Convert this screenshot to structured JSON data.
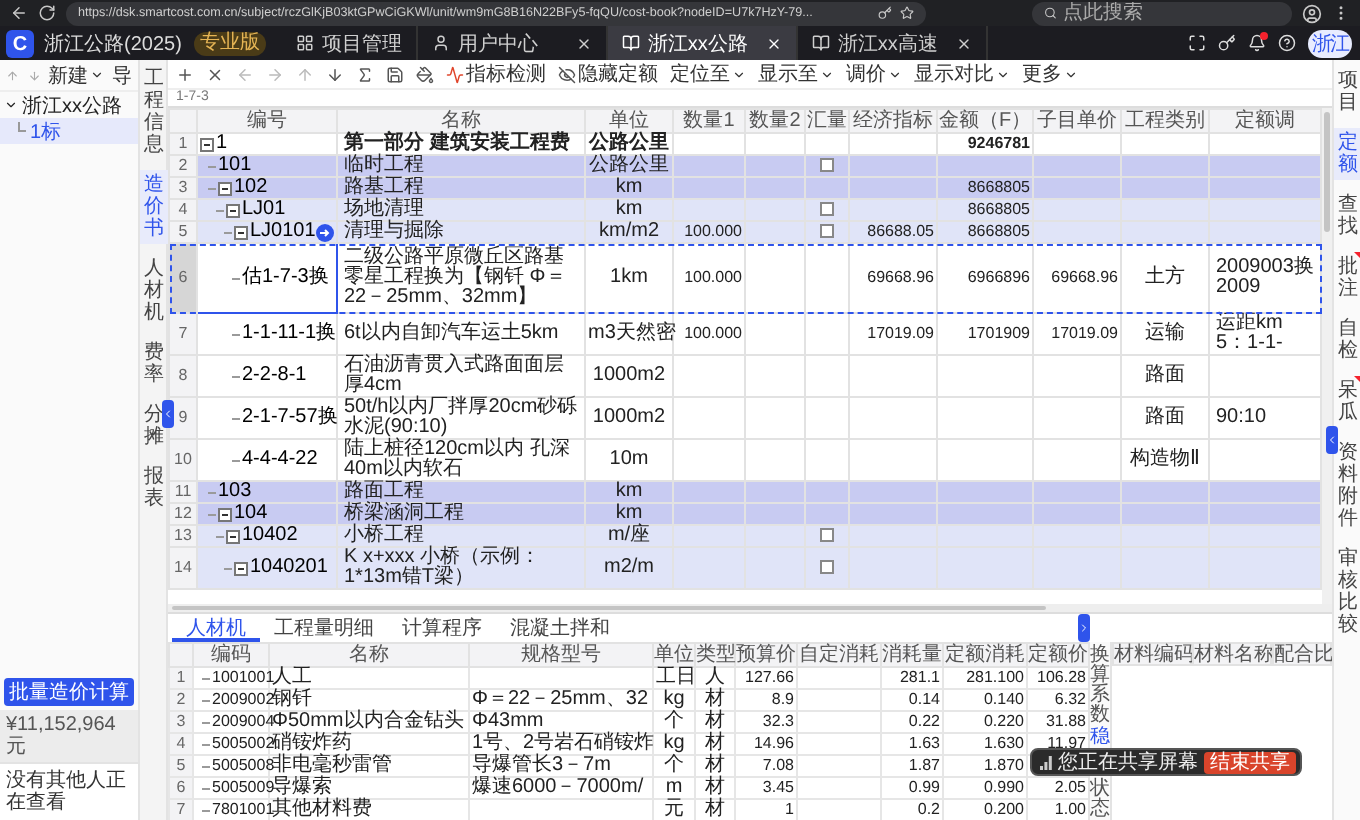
{
  "browser": {
    "url": "https://dsk.smartcost.com.cn/subject/rczGlKjB03ktGPwCiGKWl/unit/wm9mG8B16N22BFy5-fqQU/cost-book?nodeID=U7k7HzY-79...",
    "search": {
      "placeholder": "点此搜索"
    }
  },
  "app": {
    "logo": "C",
    "name": "浙江公路(2025)",
    "badge": "专业版",
    "notification": true,
    "avatar": "浙江",
    "tabs": [
      {
        "label": "项目管理",
        "closable": false,
        "selected": false
      },
      {
        "label": "用户中心",
        "closable": true,
        "selected": false
      },
      {
        "label": "浙江xx公路",
        "closable": true,
        "selected": true
      },
      {
        "label": "浙江xx高速",
        "closable": true,
        "selected": false
      }
    ]
  },
  "project_panel": {
    "toolbar": [
      {
        "label": "新建",
        "dropdown": true
      },
      {
        "label": "导",
        "dropdown": false
      }
    ],
    "tree": [
      {
        "label": "浙江xx公路",
        "expanded": true,
        "selected": false,
        "children": [
          {
            "label": "1标",
            "selected": true
          }
        ]
      }
    ],
    "batch_button": "批量造价计算",
    "total": "¥11,152,964 元",
    "viewers": "没有其他人正在查看"
  },
  "nav": [
    {
      "label": "工程信息",
      "selected": false
    },
    {
      "label": "造价书",
      "selected": true
    },
    {
      "label": "人材机",
      "selected": false
    },
    {
      "label": "费率",
      "selected": false
    },
    {
      "label": "分摊",
      "selected": false
    },
    {
      "label": "报表",
      "selected": false
    }
  ],
  "toolbar": [
    {
      "label": "指标检测",
      "dropdown": false
    },
    {
      "label": "隐藏定额",
      "dropdown": false
    },
    {
      "label": "定位至",
      "dropdown": true
    },
    {
      "label": "显示至",
      "dropdown": true
    },
    {
      "label": "调价",
      "dropdown": true
    },
    {
      "label": "显示对比",
      "dropdown": true
    },
    {
      "label": "更多",
      "dropdown": true
    }
  ],
  "path": "1-7-3",
  "table": {
    "columns": [
      "编号",
      "名称",
      "单位",
      "数量1",
      "数量2",
      "汇量",
      "经济指标",
      "金额（F）",
      "子目单价",
      "工程类别",
      "定额调"
    ],
    "rows": [
      {
        "no": "1",
        "kind": "part",
        "code": "1",
        "name": "第一部分 建筑安装工程费",
        "unit": "公路公里",
        "amount": "9246781",
        "selected": false,
        "expanded": true,
        "children": [
          {
            "no": "2",
            "kind": "section",
            "code": "101",
            "name": "临时工程",
            "unit": "公路公里",
            "summary_checked": false,
            "selected": false
          },
          {
            "no": "3",
            "kind": "section",
            "code": "102",
            "name": "路基工程",
            "unit": "km",
            "amount": "8668805",
            "selected": false,
            "expanded": true,
            "children": [
              {
                "no": "4",
                "kind": "group",
                "code": "LJ01",
                "name": "场地清理",
                "unit": "km",
                "summary_checked": false,
                "amount": "8668805",
                "selected": false,
                "expanded": true,
                "children": [
                  {
                    "no": "5",
                    "kind": "group",
                    "code": "LJ0101",
                    "name": "清理与掘除",
                    "unit": "km/m2",
                    "qty1": "100.000",
                    "summary_checked": false,
                    "econ": "86688.05",
                    "amount": "8668805",
                    "marker": true,
                    "selected": false,
                    "expanded": true,
                    "children": [
                      {
                        "no": "6",
                        "kind": "quota",
                        "code": "估1-7-3换",
                        "name": "二级公路平原微丘区路基零星工程换为【钢钎 Φ＝22－25mm、32mm】",
                        "unit": "1km",
                        "qty1": "100.000",
                        "econ": "69668.96",
                        "amount": "6966896",
                        "unit_price": "69668.96",
                        "category": "土方",
                        "adjust": "2009003换2009",
                        "selected": true
                      },
                      {
                        "no": "7",
                        "kind": "quota",
                        "code": "1-1-11-1换",
                        "name": "6t以内自卸汽车运土5km",
                        "unit": "m3天然密",
                        "qty1": "100.000",
                        "econ": "17019.09",
                        "amount": "1701909",
                        "unit_price": "17019.09",
                        "category": "运输",
                        "adjust": "运距km 5：1-1-",
                        "selected": false
                      },
                      {
                        "no": "8",
                        "kind": "quota",
                        "code": "2-2-8-1",
                        "name": "石油沥青贯入式路面面层厚4cm",
                        "unit": "1000m2",
                        "category": "路面",
                        "selected": false
                      },
                      {
                        "no": "9",
                        "kind": "quota",
                        "code": "2-1-7-57换",
                        "name": "50t/h以内厂拌厚20cm砂砾水泥(90:10)",
                        "unit": "1000m2",
                        "category": "路面",
                        "adjust": "90:10",
                        "selected": false
                      },
                      {
                        "no": "10",
                        "kind": "quota",
                        "code": "4-4-4-22",
                        "name": "陆上桩径120cm以内 孔深40m以内软石",
                        "unit": "10m",
                        "category": "构造物Ⅱ",
                        "selected": false
                      }
                    ]
                  }
                ]
              }
            ]
          },
          {
            "no": "11",
            "kind": "section",
            "code": "103",
            "name": "路面工程",
            "unit": "km",
            "selected": false
          },
          {
            "no": "12",
            "kind": "section",
            "code": "104",
            "name": "桥梁涵洞工程",
            "unit": "km",
            "selected": false,
            "expanded": true,
            "children": [
              {
                "no": "13",
                "kind": "group",
                "code": "10402",
                "name": "小桥工程",
                "unit": "m/座",
                "summary_checked": false,
                "selected": false,
                "expanded": true,
                "children": [
                  {
                    "no": "14",
                    "kind": "group",
                    "code": "1040201",
                    "name": "K x+xxx 小桥（示例：1*13m错T梁）",
                    "unit": "m2/m",
                    "summary_checked": false,
                    "selected": false,
                    "expanded": true
                  }
                ]
              }
            ]
          }
        ]
      }
    ]
  },
  "detail": {
    "tabs": [
      {
        "label": "人材机",
        "selected": true
      },
      {
        "label": "工程量明细",
        "selected": false
      },
      {
        "label": "计算程序",
        "selected": false
      },
      {
        "label": "混凝土拌和",
        "selected": false
      }
    ],
    "columns": [
      "编码",
      "名称",
      "规格型号",
      "单位",
      "类型",
      "预算价",
      "自定消耗",
      "消耗量",
      "定额消耗",
      "定额价"
    ],
    "rows": [
      {
        "no": "1",
        "code": "1001001",
        "name": "人工",
        "unit": "工日",
        "type": "人",
        "price": "127.66",
        "consumption": "281.1",
        "quota_consumption": "281.100",
        "quota_price": "106.28"
      },
      {
        "no": "2",
        "code": "2009002",
        "name": "钢钎",
        "spec": "Φ＝22－25mm、32",
        "unit": "kg",
        "type": "材",
        "price": "8.9",
        "consumption": "0.14",
        "quota_consumption": "0.140",
        "quota_price": "6.32"
      },
      {
        "no": "3",
        "code": "2009004",
        "name": "Φ50mm以内合金钻头",
        "spec": "Φ43mm",
        "unit": "个",
        "type": "材",
        "price": "32.3",
        "consumption": "0.22",
        "quota_consumption": "0.220",
        "quota_price": "31.88"
      },
      {
        "no": "4",
        "code": "5005002",
        "name": "硝铵炸药",
        "spec": "1号、2号岩石硝铵炸",
        "unit": "kg",
        "type": "材",
        "price": "14.96",
        "consumption": "1.63",
        "quota_consumption": "1.630",
        "quota_price": "11.97"
      },
      {
        "no": "5",
        "code": "5005008",
        "name": "非电毫秒雷管",
        "spec": "导爆管长3－7m",
        "unit": "个",
        "type": "材",
        "price": "7.08",
        "consumption": "1.87",
        "quota_consumption": "1.870"
      },
      {
        "no": "6",
        "code": "5005009",
        "name": "导爆索",
        "spec": "爆速6000－7000m/",
        "unit": "m",
        "type": "材",
        "price": "3.45",
        "consumption": "0.99",
        "quota_consumption": "0.990",
        "quota_price": "2.05"
      },
      {
        "no": "7",
        "code": "7801001",
        "name": "其他材料费",
        "unit": "元",
        "type": "材",
        "price": "1",
        "consumption": "0.2",
        "quota_consumption": "0.200",
        "quota_price": "1.00"
      }
    ],
    "side_tabs": [
      {
        "label": "换算系数",
        "selected": false
      },
      {
        "label": "稳",
        "selected": true
      },
      {
        "label": "状态",
        "selected": false
      }
    ],
    "mix_columns": [
      "材料编码",
      "材料名称",
      "配合比"
    ]
  },
  "sidebar": [
    {
      "label": "项目",
      "selected": false,
      "flag": false
    },
    {
      "label": "定额",
      "selected": true,
      "flag": false
    },
    {
      "label": "查找",
      "selected": false,
      "flag": false
    },
    {
      "label": "批注",
      "selected": false,
      "flag": true
    },
    {
      "label": "自检",
      "selected": false,
      "flag": false
    },
    {
      "label": "呆瓜",
      "selected": false,
      "flag": true
    },
    {
      "label": "资料附件",
      "selected": false,
      "flag": false
    },
    {
      "label": "审核比较",
      "selected": false,
      "flag": false
    }
  ],
  "share_toast": {
    "text": "您正在共享屏幕",
    "button": "结束共享"
  }
}
